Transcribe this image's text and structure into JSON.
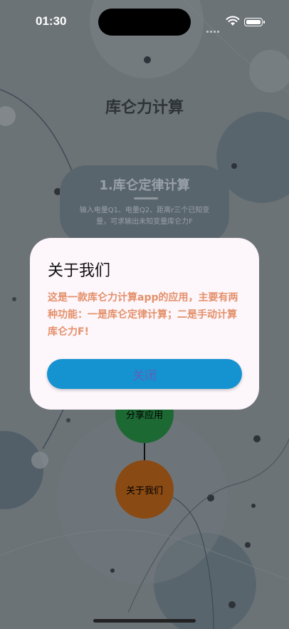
{
  "status_bar": {
    "time": "01:30"
  },
  "page": {
    "title": "库仑力计算"
  },
  "feature_card": {
    "title": "1.库仑定律计算",
    "description": "输入电量Q1、电量Q2、距离r三个已知变量，可求输出未知变量库仑力F"
  },
  "buttons": {
    "share": "分享应用",
    "about": "关于我们"
  },
  "dialog": {
    "title": "关于我们",
    "body": "这是一款库仑力计算app的应用，主要有两种功能：一是库仑定律计算；二是手动计算库仑力F!",
    "close_label": "关闭"
  },
  "colors": {
    "background": "#6c7377",
    "dialog_bg": "#fdf6fb",
    "dialog_text": "#e4906a",
    "close_button": "#1592d0",
    "share_button": "#1c6934",
    "about_button": "#8a4a14"
  }
}
